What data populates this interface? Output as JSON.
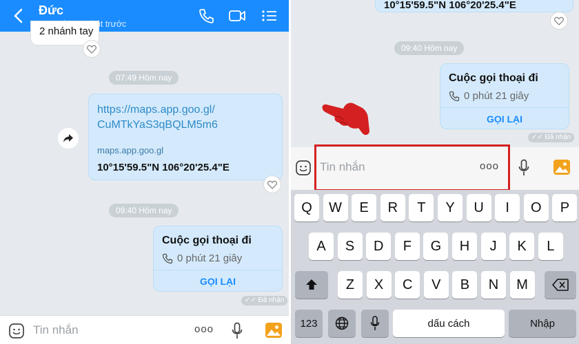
{
  "left": {
    "header": {
      "name": "Đức",
      "status": "Truy cập 25 phút trước"
    },
    "partial_message": "2 nhánh tay",
    "chip_1": "07:49 Hôm nay",
    "link_message": {
      "url_line1": "https://maps.app.goo.gl/",
      "url_line2": "CuMTkYaS3qBQLM5m6",
      "host": "maps.app.goo.gl",
      "coords": "10°15'59.5\"N 106°20'25.4\"E"
    },
    "chip_2": "09:40 Hôm nay",
    "call_card": {
      "title": "Cuộc gọi thoại đi",
      "duration": "0 phút 21 giây",
      "action": "GỌI LẠI"
    },
    "received": "Đã nhận",
    "input": {
      "placeholder": "Tin nhắn",
      "more": "ooo"
    }
  },
  "right": {
    "partial_coords": "10°15'59.5\"N 106°20'25.4\"E",
    "chip": "09:40 Hôm nay",
    "call_card": {
      "title": "Cuộc gọi thoại đi",
      "duration": "0 phút 21 giây",
      "action": "GỌI LẠI"
    },
    "received": "Đã nhận",
    "input": {
      "placeholder": "Tin nhắn",
      "more": "ooo"
    },
    "keyboard": {
      "row1": [
        "Q",
        "W",
        "E",
        "R",
        "T",
        "Y",
        "U",
        "I",
        "O",
        "P"
      ],
      "row2": [
        "A",
        "S",
        "D",
        "F",
        "G",
        "H",
        "J",
        "K",
        "L"
      ],
      "row3": [
        "Z",
        "X",
        "C",
        "V",
        "B",
        "N",
        "M"
      ],
      "numbers_key": "123",
      "space_key": "dấu cách",
      "return_key": "Nhập"
    }
  },
  "colors": {
    "header": "#1a8cff",
    "bubble": "#d4eafc",
    "highlight": "#d42020",
    "keyboard": "#d3d6dc"
  }
}
